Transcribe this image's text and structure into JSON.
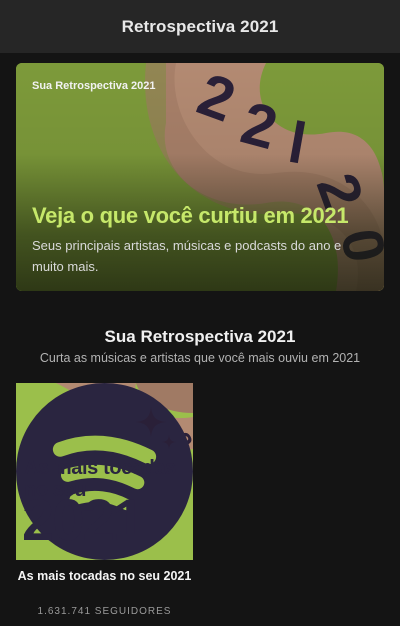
{
  "header": {
    "title": "Retrospectiva 2021"
  },
  "hero": {
    "eyebrow": "Sua Retrospectiva 2021",
    "title": "Veja o que você curtiu em 2021",
    "description": "Seus principais artistas, músicas e podcasts do ano e muito mais."
  },
  "section": {
    "title": "Sua Retrospectiva 2021",
    "subtitle": "Curta as músicas e artistas que você mais ouviu em 2021"
  },
  "playlist": {
    "cover_text": "As mais tocadas no seu",
    "cover_year": "2021",
    "title": "As mais tocadas no seu 2021",
    "followers": "1.631.741 SEGUIDORES"
  },
  "colors": {
    "background": "#141414",
    "header_bg": "#262626",
    "hero_green": "#7d9a3a",
    "accent_lime": "#c6e86a",
    "ribbon_tan": "#b38a72",
    "cover_text": "#2a2540"
  },
  "icons": [
    "spotify-logo-icon",
    "sparkle-icon"
  ]
}
